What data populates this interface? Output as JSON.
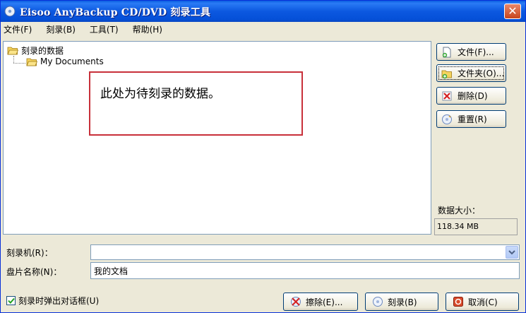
{
  "window": {
    "title": "Eisoo AnyBackup CD/DVD 刻录工具",
    "close_label": "✕"
  },
  "menu": {
    "items": [
      "文件(F)",
      "刻录(B)",
      "工具(T)",
      "帮助(H)"
    ]
  },
  "tree": {
    "root_label": "刻录的数据",
    "child_label": "My Documents"
  },
  "annotation": {
    "text": "此处为待刻录的数据。",
    "border_color": "#c8303a"
  },
  "side_buttons": {
    "file": {
      "label": "文件(F)...",
      "icon": "file-add-icon"
    },
    "folder": {
      "label": "文件夹(O)...",
      "icon": "folder-add-icon"
    },
    "delete": {
      "label": "删除(D)",
      "icon": "delete-icon"
    },
    "reset": {
      "label": "重置(R)",
      "icon": "reset-icon"
    }
  },
  "data_size": {
    "label": "数据大小：",
    "value": "118.34 MB"
  },
  "fields": {
    "recorder_label": "刻录机(R)：",
    "recorder_value": "",
    "disc_name_label": "盘片名称(N)：",
    "disc_name_value": "我的文档"
  },
  "bottom": {
    "checkbox_label": "刻录时弹出对话框(U)",
    "checkbox_checked": true,
    "erase_label": "擦除(E)...",
    "burn_label": "刻录(B)",
    "cancel_label": "取消(C)"
  },
  "colors": {
    "titlebar": "#0550d8",
    "window_bg": "#ece9d8",
    "button_border": "#003c74"
  }
}
